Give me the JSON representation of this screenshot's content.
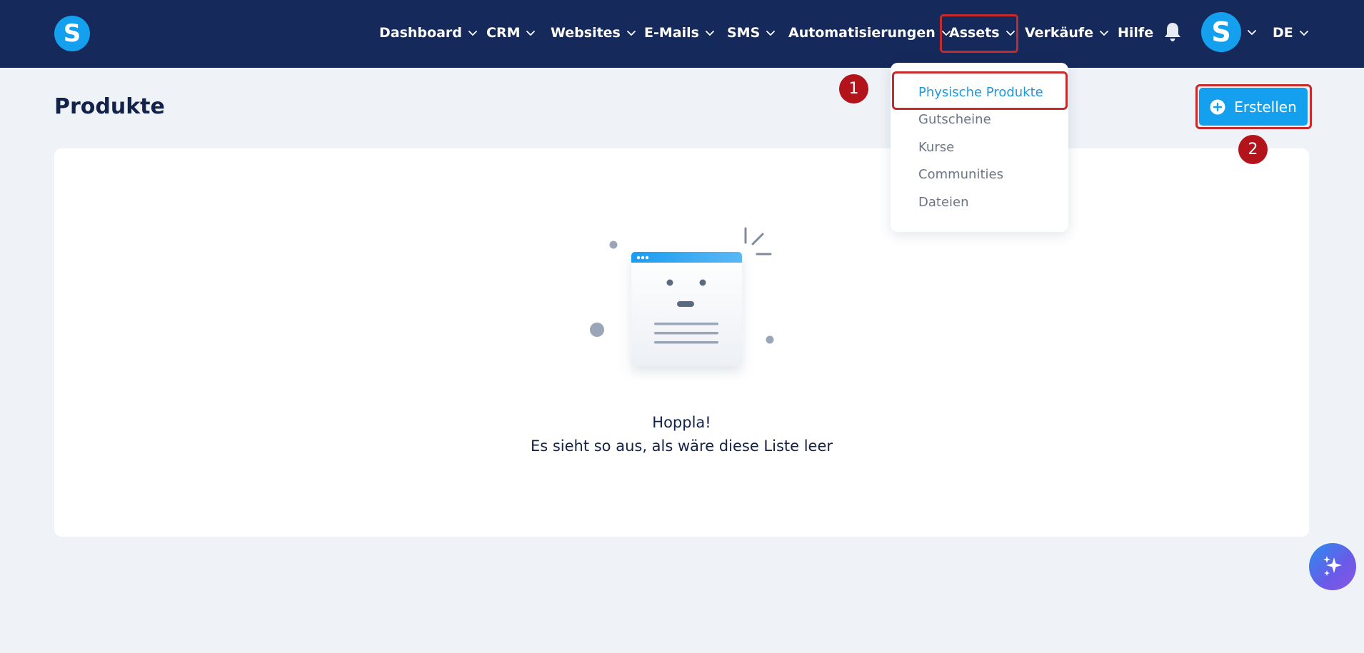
{
  "brand": {
    "logo_letter": "S"
  },
  "nav": {
    "items": [
      {
        "label": "Dashboard"
      },
      {
        "label": "CRM"
      },
      {
        "label": "Websites"
      },
      {
        "label": "E-Mails"
      },
      {
        "label": "SMS"
      },
      {
        "label": "Automatisierungen"
      },
      {
        "label": "Assets"
      },
      {
        "label": "Verkäufe"
      },
      {
        "label": "Hilfe"
      }
    ],
    "avatar_letter": "S",
    "language": "DE"
  },
  "page": {
    "title": "Produkte",
    "create_button": "Erstellen"
  },
  "dropdown": {
    "items": [
      {
        "label": "Physische Produkte"
      },
      {
        "label": "Gutscheine"
      },
      {
        "label": "Kurse"
      },
      {
        "label": "Communities"
      },
      {
        "label": "Dateien"
      }
    ]
  },
  "empty_state": {
    "line1": "Hoppla!",
    "line2": "Es sieht so aus, als wäre diese Liste leer"
  },
  "annotations": {
    "step1": "1",
    "step2": "2"
  },
  "colors": {
    "topbar": "#15295b",
    "accent": "#14a0ef",
    "highlight": "#c62a2a",
    "badge": "#b3141b",
    "active_link": "#1c98dc"
  }
}
